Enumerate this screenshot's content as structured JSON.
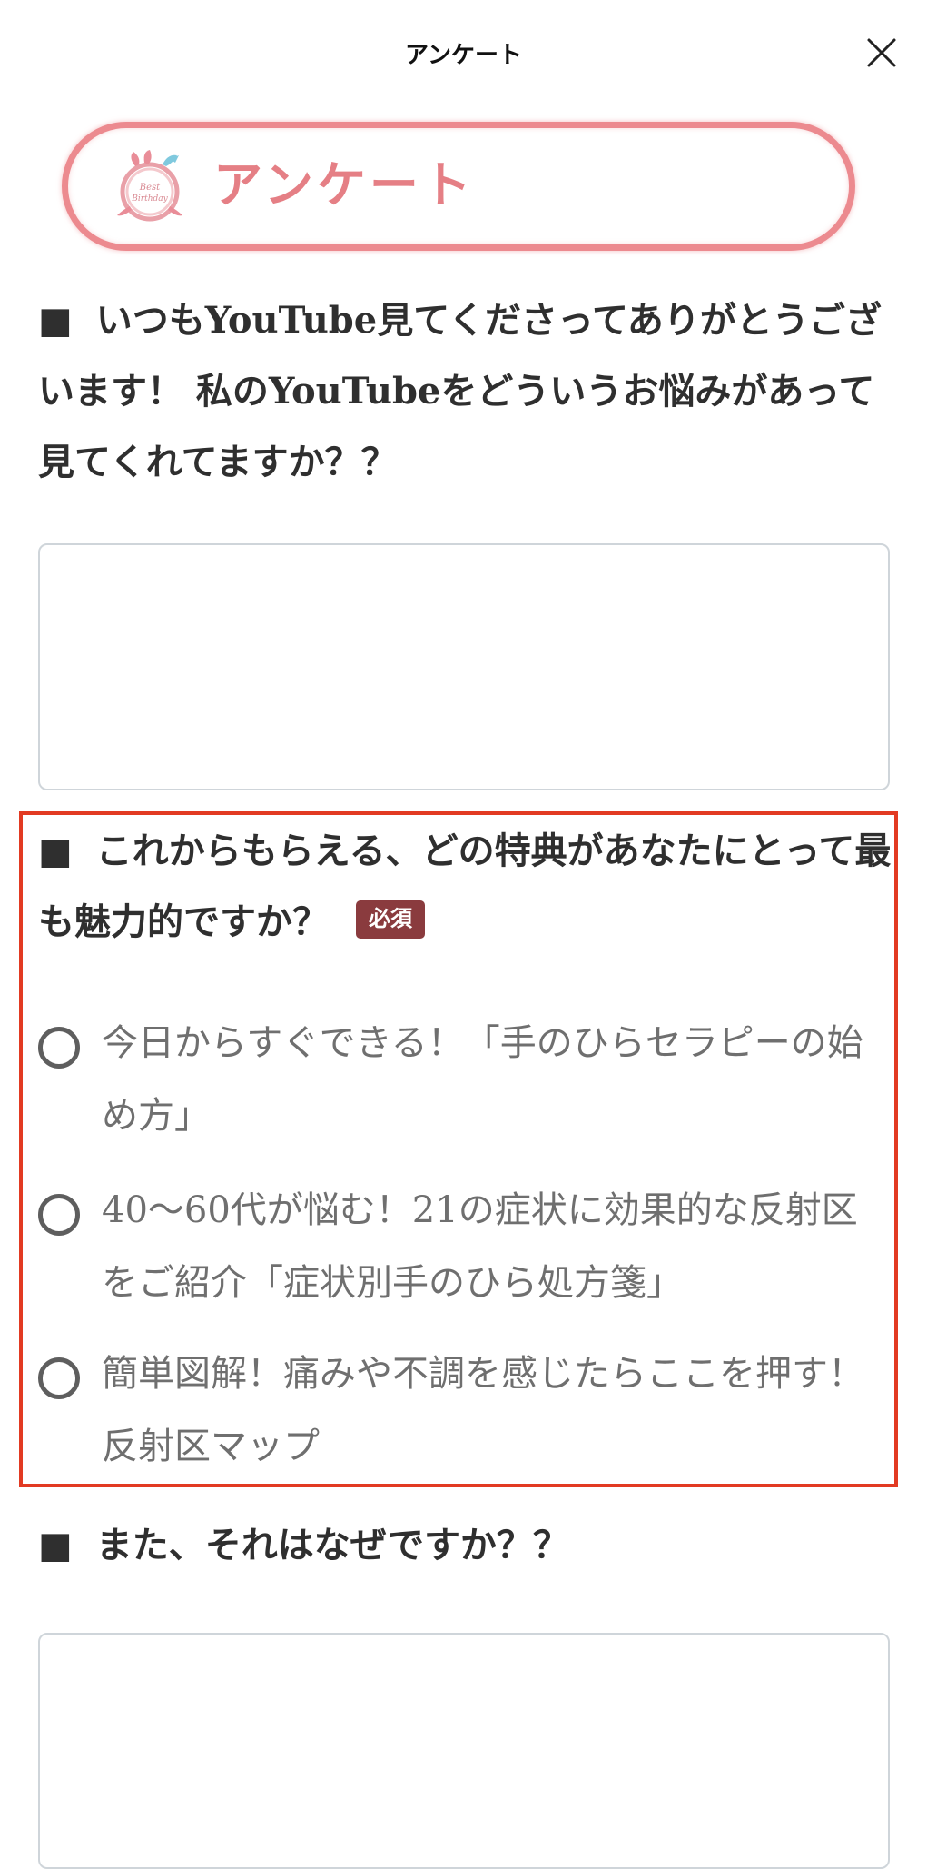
{
  "header": {
    "title": "アンケート"
  },
  "banner": {
    "logo_text": "Best Birthday",
    "title": "アンケート"
  },
  "questions": [
    {
      "marker": "■",
      "text": "いつもYouTube見てくださってありがとうございます！ 私のYouTubeをどういうお悩みがあって見てくれてますか？？",
      "answer": ""
    },
    {
      "marker": "■",
      "text": "これからもらえる、どの特典があなたにとって最も魅力的ですか？",
      "required_label": "必須",
      "options": [
        "今日からすぐできる！「手のひらセラピーの始め方」",
        "40〜60代が悩む！21の症状に効果的な反射区をご紹介「症状別手のひら処方箋」",
        "簡単図解！痛みや不調を感じたらここを押す！反射区マップ"
      ]
    },
    {
      "marker": "■",
      "text": "また、それはなぜですか？？",
      "answer": ""
    }
  ],
  "colors": {
    "banner_border": "#ec8a8f",
    "banner_text": "#e57f85",
    "highlight": "#e23a22",
    "required_badge": "#8a3b3e"
  }
}
